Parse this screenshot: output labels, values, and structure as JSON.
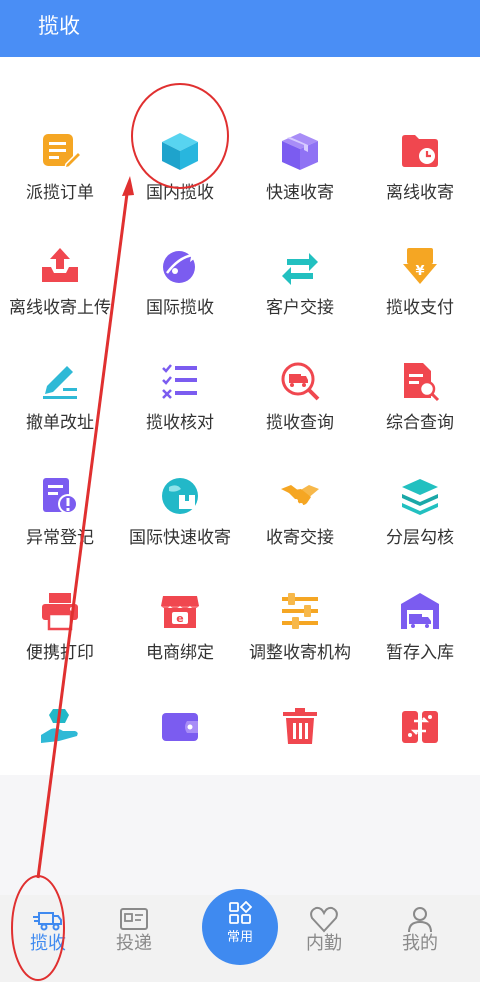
{
  "header": {
    "title": "揽收"
  },
  "colors": {
    "header": "#4a8ef5",
    "accent": "#3f8af0",
    "annotation": "#e03030"
  },
  "grid": [
    {
      "label": "派揽订单",
      "icon": "edit-document-icon"
    },
    {
      "label": "国内揽收",
      "icon": "cube-box-icon"
    },
    {
      "label": "快速收寄",
      "icon": "package-icon"
    },
    {
      "label": "离线收寄",
      "icon": "folder-clock-icon"
    },
    {
      "label": "离线收寄上传",
      "icon": "upload-tray-icon"
    },
    {
      "label": "国际揽收",
      "icon": "globe-plane-icon"
    },
    {
      "label": "客户交接",
      "icon": "swap-arrows-icon"
    },
    {
      "label": "揽收支付",
      "icon": "yen-payment-icon"
    },
    {
      "label": "撤单改址",
      "icon": "pen-edit-icon"
    },
    {
      "label": "揽收核对",
      "icon": "checklist-icon"
    },
    {
      "label": "揽收查询",
      "icon": "truck-search-icon"
    },
    {
      "label": "综合查询",
      "icon": "document-search-icon"
    },
    {
      "label": "异常登记",
      "icon": "warning-document-icon"
    },
    {
      "label": "国际快速收寄",
      "icon": "globe-box-icon"
    },
    {
      "label": "收寄交接",
      "icon": "handshake-icon"
    },
    {
      "label": "分层勾核",
      "icon": "layers-icon"
    },
    {
      "label": "便携打印",
      "icon": "printer-icon"
    },
    {
      "label": "电商绑定",
      "icon": "shop-icon"
    },
    {
      "label": "调整收寄机构",
      "icon": "sliders-icon"
    },
    {
      "label": "暂存入库",
      "icon": "warehouse-truck-icon"
    },
    {
      "label": "",
      "icon": "hand-box-icon"
    },
    {
      "label": "",
      "icon": "wallet-icon"
    },
    {
      "label": "",
      "icon": "trash-icon"
    },
    {
      "label": "",
      "icon": "exchange-card-icon"
    }
  ],
  "tabs": [
    {
      "label": "揽收",
      "icon": "truck-icon",
      "active": true
    },
    {
      "label": "投递",
      "icon": "id-card-icon",
      "active": false
    },
    {
      "label": "常用",
      "icon": "apps-grid-icon",
      "active": false
    },
    {
      "label": "内勤",
      "icon": "heart-icon",
      "active": false
    },
    {
      "label": "我的",
      "icon": "user-icon",
      "active": false
    }
  ]
}
